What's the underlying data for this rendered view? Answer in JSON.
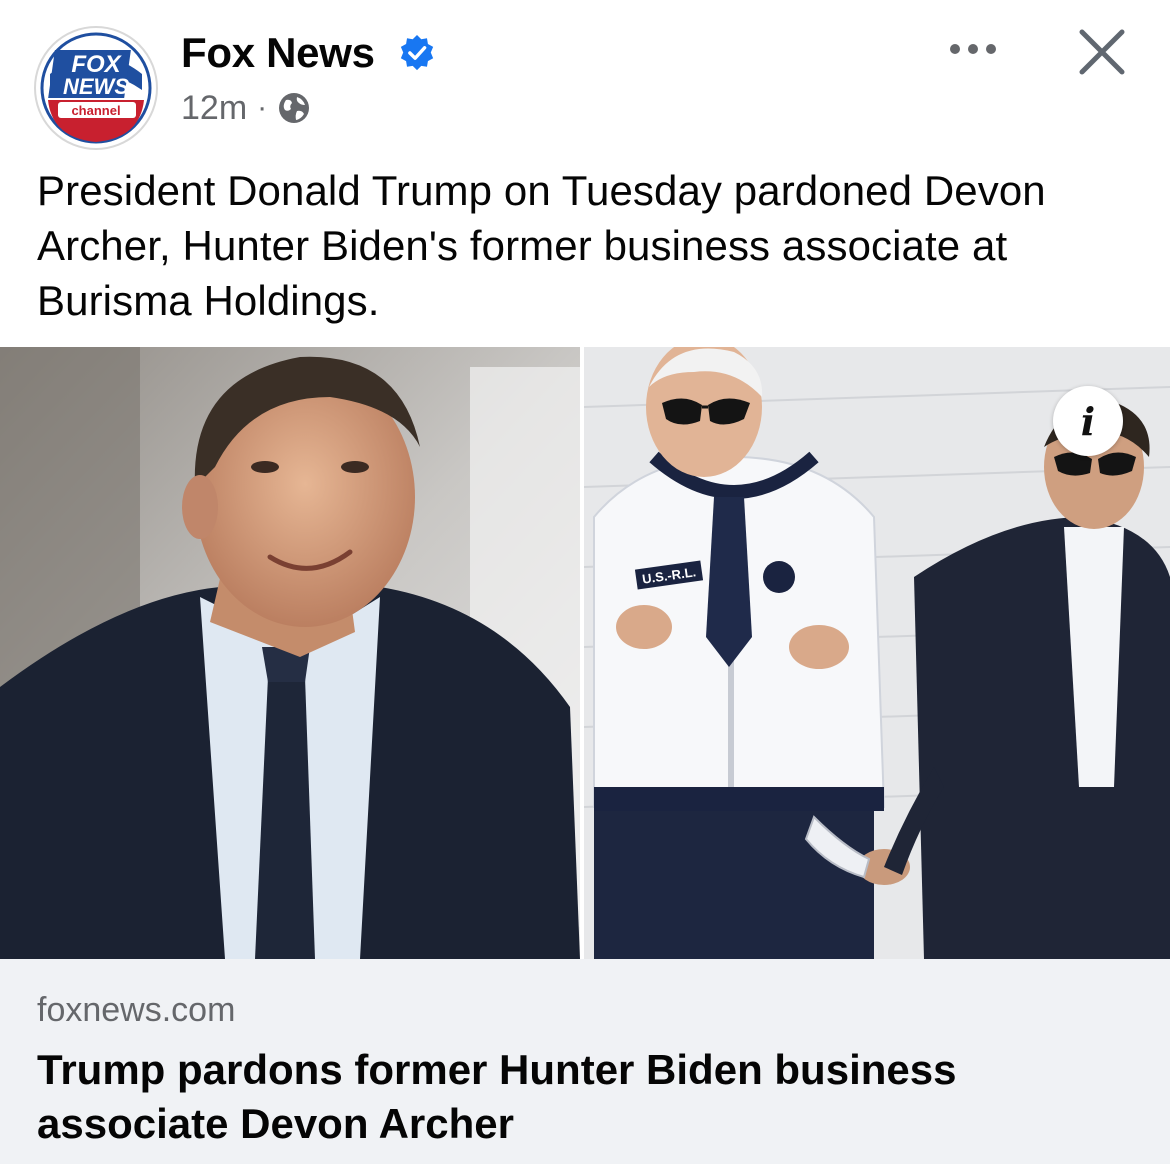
{
  "post": {
    "page_name": "Fox News",
    "verified": true,
    "timestamp": "12m",
    "separator": "·",
    "audience_icon": "globe-icon",
    "text": "President Donald Trump on Tuesday pardoned Devon Archer, Hunter Biden's former business associate at Burisma Holdings."
  },
  "avatar": {
    "logo_line1": "FOX",
    "logo_line2": "NEWS",
    "logo_line3": "channel"
  },
  "header_actions": {
    "more_icon": "more-horizontal-icon",
    "close_icon": "close-icon"
  },
  "media": {
    "left_photo": "photo-devon-archer",
    "right_photo": "photo-biden-family",
    "jacket_patch": "U.S.-R.L.",
    "info_label": "i"
  },
  "link_preview": {
    "domain": "foxnews.com",
    "title": "Trump pardons former Hunter Biden business associate Devon Archer"
  },
  "colors": {
    "verified_blue": "#1877f2",
    "meta_gray": "#65676b",
    "card_bg": "#f0f2f5",
    "fox_blue": "#1f4fa0",
    "fox_red": "#c8202f"
  }
}
